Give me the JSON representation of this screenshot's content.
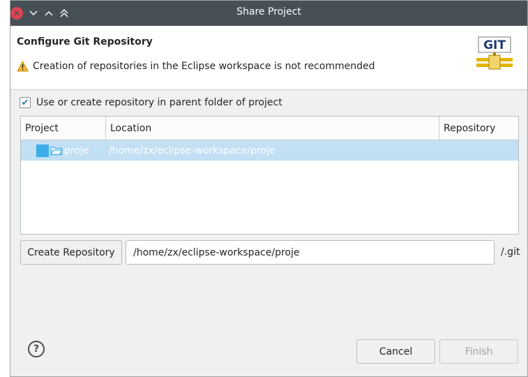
{
  "window": {
    "title": "Share Project",
    "close_glyph": "✕",
    "minimize_glyph": "⌄",
    "maximize_glyph": "⌃",
    "keep_above_glyph": "⌃"
  },
  "banner": {
    "title": "Configure Git Repository",
    "message": "Creation of repositories in the Eclipse workspace is not recommended",
    "logo_text": "GIT",
    "warning_icon": "warning-triangle-icon"
  },
  "options": {
    "use_parent_label": "Use or create repository in parent folder of project",
    "use_parent_checked": true,
    "check_glyph": "✔"
  },
  "table": {
    "columns": [
      "Project",
      "Location",
      "Repository"
    ],
    "rows": [
      {
        "project": "proje",
        "location": "/home/zx/eclipse-workspace/proje",
        "repository": ""
      }
    ]
  },
  "create": {
    "button_label": "Create Repository",
    "path_value": "/home/zx/eclipse-workspace/proje",
    "suffix": "/.git"
  },
  "footer": {
    "help_glyph": "?",
    "cancel_label": "Cancel",
    "finish_label": "Finish"
  },
  "colors": {
    "titlebar": "#475057",
    "close": "#da4453",
    "selection": "#c2dff4",
    "accent": "#3daee9"
  }
}
